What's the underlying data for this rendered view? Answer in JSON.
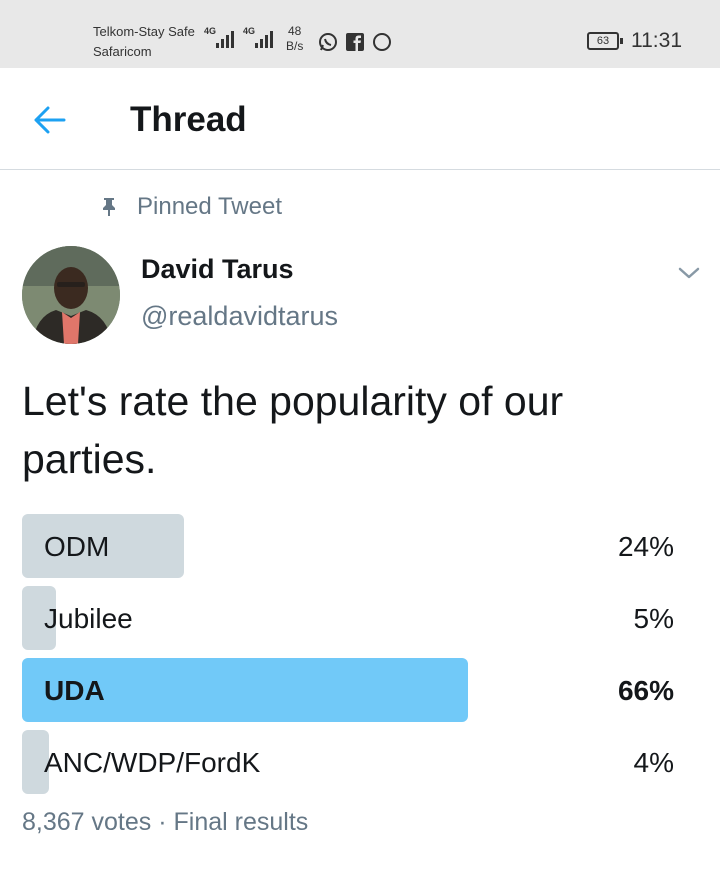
{
  "status_bar": {
    "carrier_line1": "Telkom-Stay Safe",
    "carrier_line2": "Safaricom",
    "network_1": "4G",
    "network_2": "4G",
    "net_speed_value": "48",
    "net_speed_unit": "B/s",
    "app_icons": [
      "whatsapp-icon",
      "facebook-icon",
      "circle-notification-icon"
    ],
    "battery": "63",
    "time": "11:31"
  },
  "header": {
    "title": "Thread",
    "back_icon": "back-arrow-icon"
  },
  "tweet": {
    "pinned_label": "Pinned Tweet",
    "author_name": "David Tarus",
    "author_handle": "@realdavidtarus",
    "text": "Let's rate the popularity of our parties.",
    "poll": {
      "options": [
        {
          "label": "ODM",
          "percent_text": "24%",
          "percent": 24,
          "winner": false
        },
        {
          "label": "Jubilee",
          "percent_text": "5%",
          "percent": 5,
          "winner": false
        },
        {
          "label": "UDA",
          "percent_text": "66%",
          "percent": 66,
          "winner": true
        },
        {
          "label": "ANC/WDP/FordK",
          "percent_text": "4%",
          "percent": 4,
          "winner": false
        }
      ],
      "votes": "8,367 votes",
      "separator": "·",
      "status": "Final results"
    }
  },
  "colors": {
    "accent": "#1da1f2",
    "winner_bar": "#71c9f8",
    "other_bar": "#cfd9de",
    "secondary_text": "#657786"
  }
}
